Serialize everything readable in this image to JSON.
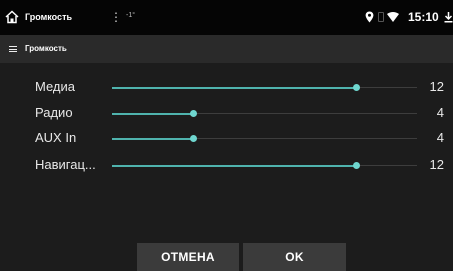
{
  "status_bar": {
    "title": "Громкость",
    "temperature": "-1°",
    "time": "15:10",
    "icons": [
      "home-icon",
      "overflow-menu-icon",
      "location-icon",
      "battery-icon",
      "wifi-icon",
      "download-icon"
    ]
  },
  "app_bar": {
    "title": "Громкость",
    "menu_icon": "hamburger-menu-icon"
  },
  "sliders": [
    {
      "label": "Медиа",
      "value": "12",
      "level": 12,
      "max": 15
    },
    {
      "label": "Радио",
      "value": "4",
      "level": 4,
      "max": 15
    },
    {
      "label": "AUX In",
      "value": "4",
      "level": 4,
      "max": 15
    },
    {
      "label": "Навигац...",
      "value": "12",
      "level": 12,
      "max": 15
    }
  ],
  "buttons": {
    "cancel": "ОТМЕНА",
    "ok": "OK"
  },
  "colors": {
    "accent": "#4fb3ad",
    "background": "#1c1c1c",
    "button": "#3b3b3b"
  }
}
